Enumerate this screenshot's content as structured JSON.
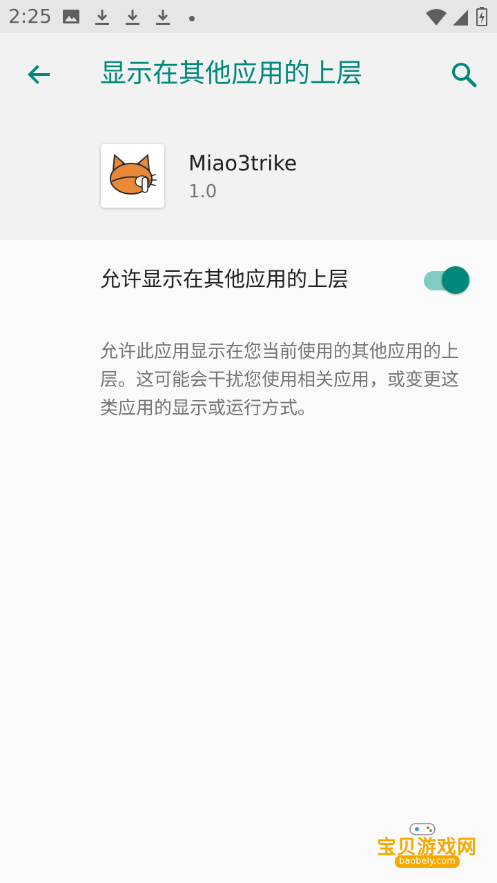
{
  "status_bar": {
    "time": "2:25",
    "icons": [
      "image-icon",
      "download-icon",
      "download-icon",
      "download-icon",
      "dot-icon",
      "wifi-icon",
      "signal-icon",
      "battery-icon"
    ]
  },
  "header": {
    "title": "显示在其他应用的上层",
    "back_icon": "arrow-back-icon",
    "search_icon": "search-icon"
  },
  "app": {
    "name": "Miao3trike",
    "version": "1.0",
    "icon": "cat-app-icon"
  },
  "setting": {
    "label": "允许显示在其他应用的上层",
    "enabled": true,
    "description": "允许此应用显示在您当前使用的其他应用的上层。这可能会干扰您使用相关应用，或变更这类应用的显示或运行方式。"
  },
  "watermark": {
    "text": "宝贝游戏网",
    "url": "baobeiy.com"
  },
  "colors": {
    "accent": "#00897b",
    "accent_light": "#80cbc4",
    "status_bar_bg": "#e6e6e6",
    "header_bg": "#f2f2f2",
    "page_bg": "#fafafa"
  }
}
